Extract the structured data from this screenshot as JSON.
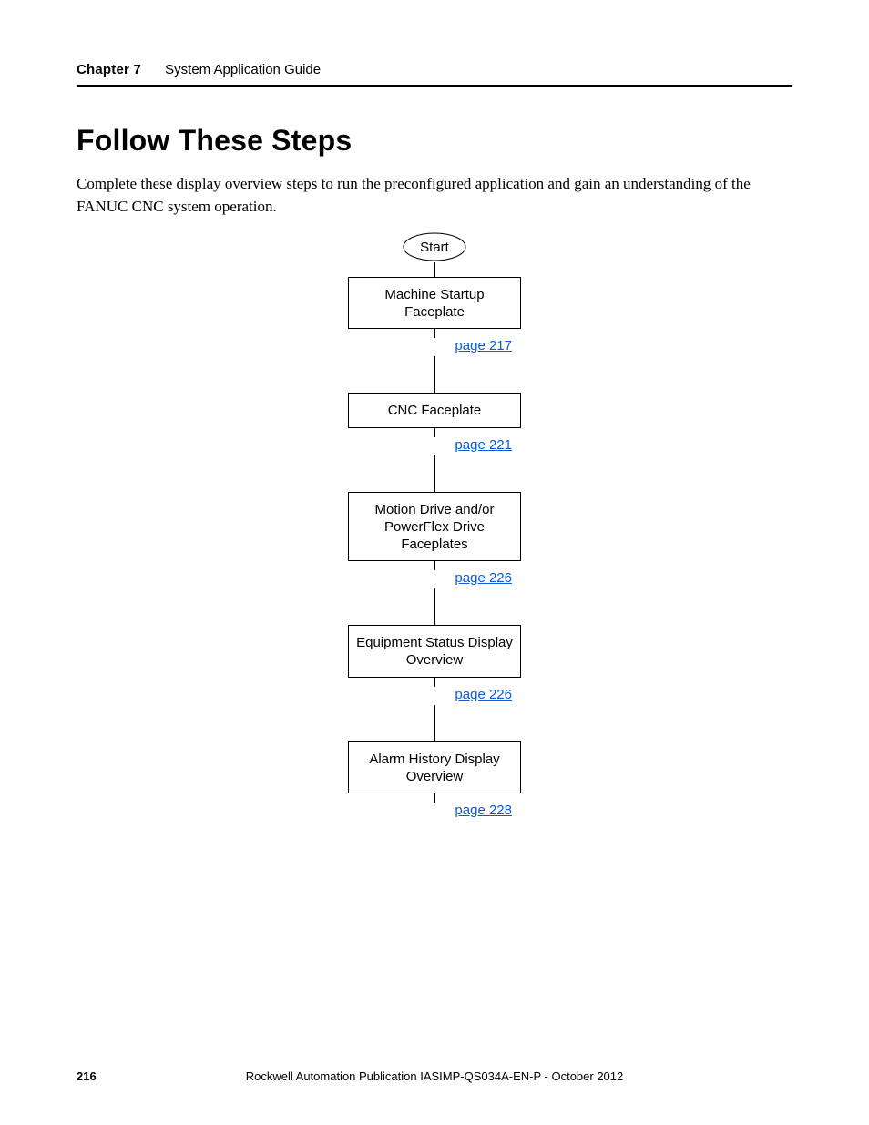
{
  "header": {
    "chapter": "Chapter 7",
    "guide": "System Application Guide"
  },
  "title": "Follow These Steps",
  "intro": "Complete these display overview steps to run the preconfigured application and gain an understanding of the FANUC CNC system operation.",
  "flow": {
    "start": "Start",
    "steps": [
      {
        "label": "Machine Startup Faceplate",
        "page_link": "page 217"
      },
      {
        "label": "CNC Faceplate",
        "page_link": "page 221"
      },
      {
        "label": "Motion Drive and/or\nPowerFlex Drive Faceplates",
        "page_link": "page 226"
      },
      {
        "label": "Equipment Status Display\nOverview",
        "page_link": "page 226"
      },
      {
        "label": "Alarm History Display\nOverview",
        "page_link": "page 228"
      }
    ]
  },
  "footer": {
    "page_number": "216",
    "publication_prefix": "Rockwell Automation Publication IASIMP-QS034A-EN-P - ",
    "publication_date": "October 2012"
  }
}
